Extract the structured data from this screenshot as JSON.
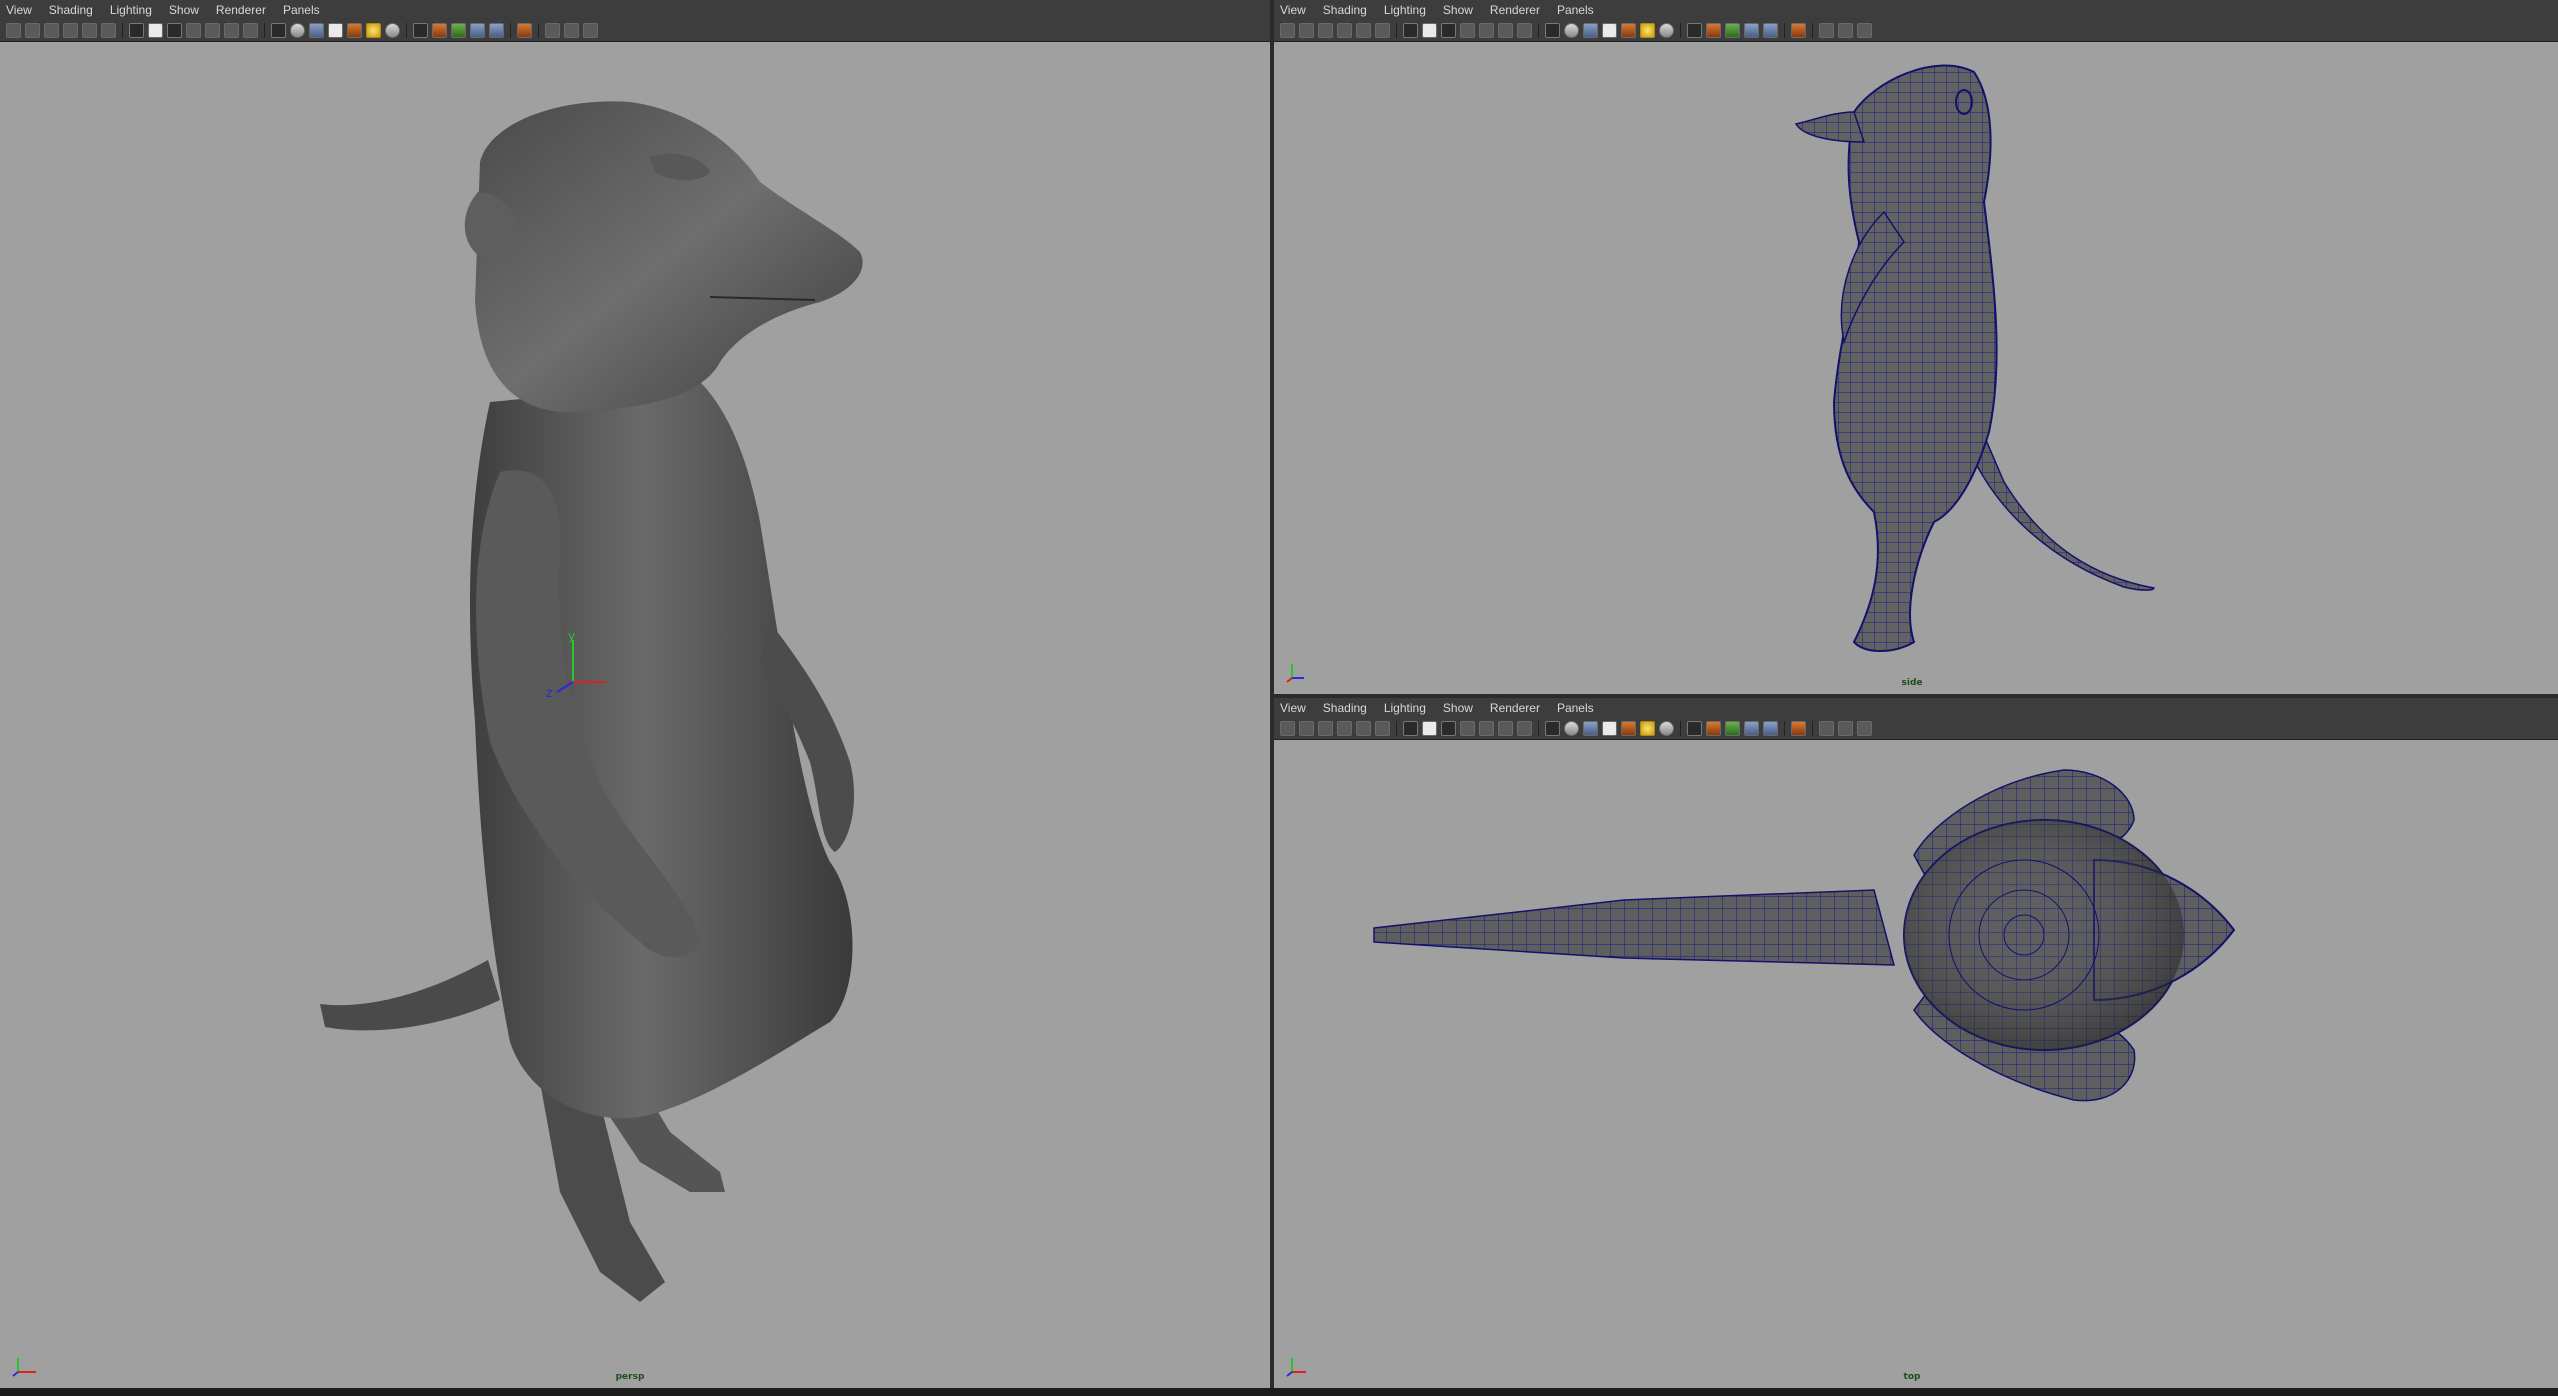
{
  "menus": [
    "View",
    "Shading",
    "Lighting",
    "Show",
    "Renderer",
    "Panels"
  ],
  "panels": {
    "persp": {
      "camera_label": "persp"
    },
    "side": {
      "camera_label": "side"
    },
    "top": {
      "camera_label": "top"
    }
  },
  "toolbar_icons": [
    "select-camera-icon",
    "camera-attributes-icon",
    "bookmark-icon",
    "image-plane-icon",
    "grease-pencil-icon",
    "2d-pan-zoom-icon",
    "sep",
    "grid-icon",
    "film-gate-icon",
    "resolution-gate-icon",
    "gate-mask-icon",
    "field-chart-icon",
    "safe-action-icon",
    "safe-title-icon",
    "sep",
    "wireframe-icon",
    "smooth-shade-icon",
    "wireframe-on-shaded-icon",
    "xray-icon",
    "textured-icon",
    "default-light-icon",
    "use-all-lights-icon",
    "sep",
    "shadows-icon",
    "screen-space-ao-icon",
    "motion-blur-icon",
    "multisample-aa-icon",
    "depth-of-field-icon",
    "sep",
    "isolate-select-icon",
    "sep",
    "hud-icon",
    "xray-joints-icon",
    "xray-active-icon"
  ],
  "colors": {
    "viewport_bg": "#a0a0a0",
    "panel_bar": "#3d3d3d",
    "wire": "#1a1a8a",
    "mesh_mid": "#5c5c5c"
  }
}
